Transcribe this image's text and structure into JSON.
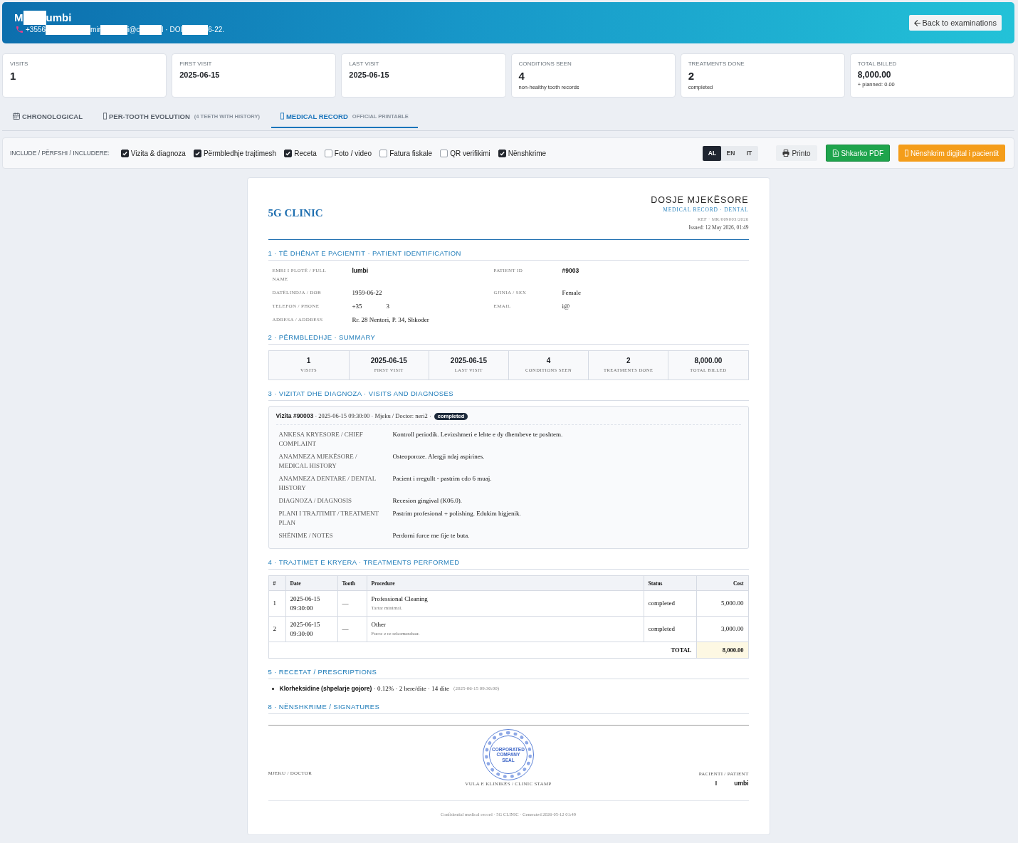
{
  "header": {
    "name_parts": [
      "M",
      "umbi"
    ],
    "contact_parts": [
      "+3556",
      "mir",
      "i@c",
      "l · DOI",
      "6-22."
    ],
    "back_button": "Back to examinations"
  },
  "stats": [
    {
      "label": "VISITS",
      "value": "1",
      "kind": "count"
    },
    {
      "label": "FIRST VISIT",
      "value": "2025-06-15",
      "kind": "date"
    },
    {
      "label": "LAST VISIT",
      "value": "2025-06-15",
      "kind": "date"
    },
    {
      "label": "CONDITIONS SEEN",
      "value": "4",
      "kind": "count",
      "note": "non-healthy tooth records"
    },
    {
      "label": "TREATMENTS DONE",
      "value": "2",
      "kind": "count",
      "note": "completed"
    },
    {
      "label": "TOTAL BILLED",
      "value": "8,000.00",
      "kind": "amount",
      "note": "+ planned: 0.00"
    }
  ],
  "tabs": [
    {
      "label": "CHRONOLOGICAL",
      "selected": false
    },
    {
      "label": "PER-TOOTH EVOLUTION",
      "note": "(4 TEETH WITH HISTORY)",
      "selected": false
    },
    {
      "label": "MEDICAL RECORD",
      "note": "OFFICIAL PRINTABLE",
      "selected": true
    }
  ],
  "toolbar": {
    "include_label": "INCLUDE / PËRFSHI / INCLUDERE:",
    "options": [
      {
        "label": "Vizita & diagnoza",
        "checked": true
      },
      {
        "label": "Përmbledhje trajtimesh",
        "checked": true
      },
      {
        "label": "Receta",
        "checked": true
      },
      {
        "label": "Foto / video",
        "checked": false
      },
      {
        "label": "Fatura fiskale",
        "checked": false
      },
      {
        "label": "QR verifikimi",
        "checked": false
      },
      {
        "label": "Nënshkrime",
        "checked": true
      }
    ],
    "languages": [
      {
        "label": "AL",
        "selected": true
      },
      {
        "label": "EN",
        "selected": false
      },
      {
        "label": "IT",
        "selected": false
      }
    ],
    "buttons": [
      {
        "label": "Printo",
        "kind": "plain"
      },
      {
        "label": "Shkarko PDF",
        "kind": "success"
      },
      {
        "label": "Nënshkrim digjital i pacientit",
        "kind": "warning"
      }
    ]
  },
  "document": {
    "clinic": "5G CLINIC",
    "title": "DOSJE MJEKËSORE",
    "subtitle": "MEDICAL RECORD · DENTAL",
    "ref": "REF · MR/009003/2026",
    "issued": "Issued: 12 May 2026, 01:49",
    "identification": {
      "heading": "1 · TË DHËNAT E PACIENTIT · PATIENT IDENTIFICATION",
      "fields": [
        {
          "label": "EMRI I PLOTË / FULL NAME",
          "value": "lumbi"
        },
        {
          "label": "PATIENT ID",
          "value": "#9003"
        },
        {
          "label": "DATËLINDJA / DOB",
          "value": "1959-06-22"
        },
        {
          "label": "GJINIA / SEX",
          "value": "Female"
        },
        {
          "label": "TELEFON / PHONE",
          "parts": [
            "+35",
            "3"
          ]
        },
        {
          "label": "EMAIL",
          "value": "i@"
        },
        {
          "label": "ADRESA / ADDRESS",
          "value": "Rr. 28 Nentori, P. 34, Shkoder"
        }
      ]
    },
    "summary": {
      "heading": "2 · PËRMBLEDHJE · SUMMARY",
      "cells": [
        {
          "value": "1",
          "label": "VISITS"
        },
        {
          "value": "2025-06-15",
          "label": "FIRST VISIT"
        },
        {
          "value": "2025-06-15",
          "label": "LAST VISIT"
        },
        {
          "value": "4",
          "label": "CONDITIONS SEEN"
        },
        {
          "value": "2",
          "label": "TREATMENTS DONE"
        },
        {
          "value": "8,000.00",
          "label": "TOTAL BILLED"
        }
      ]
    },
    "visits": {
      "heading": "3 · VIZITAT DHE DIAGNOZA · VISITS AND DIAGNOSES",
      "items": [
        {
          "header": "**Vizita #90003** · 2025-06-15 09:30:00 · Mjeku / Doctor: neri2 ·",
          "status": "completed",
          "rows": [
            {
              "label": "ANKESA KRYESORE / CHIEF COMPLAINT",
              "value": "Kontroll periodik. Levizshmeri e lehte e dy dhembeve te poshtem."
            },
            {
              "label": "ANAMNEZA MJEKËSORE / MEDICAL HISTORY",
              "value": "Osteoporoze. Alergji ndaj aspirines."
            },
            {
              "label": "ANAMNEZA DENTARE / DENTAL HISTORY",
              "value": "Pacient i rregullt - pastrim cdo 6 muaj."
            },
            {
              "label": "DIAGNOZA / DIAGNOSIS",
              "value": "Recesion gingival (K06.0)."
            },
            {
              "label": "PLANI I TRAJTIMIT / TREATMENT PLAN",
              "value": "Pastrim profesional + polishing. Edukim higjenik."
            },
            {
              "label": "SHËNIME / NOTES",
              "value": "Perdorni furce me fije te buta."
            }
          ]
        }
      ]
    },
    "treatments": {
      "heading": "4 · TRAJTIMET E KRYERA · TREATMENTS PERFORMED",
      "columns": [
        "#",
        "Date",
        "Tooth",
        "Procedure",
        "Status",
        "Cost"
      ],
      "rows": [
        {
          "num": "1",
          "date": "2025-06-15 09:30:00",
          "tooth": "—",
          "procedure": "Professional Cleaning",
          "note": "Tartar minimal.",
          "status": "completed",
          "cost": "5,000.00"
        },
        {
          "num": "2",
          "date": "2025-06-15 09:30:00",
          "tooth": "—",
          "procedure": "Other",
          "note": "Furce e re rekomanduar.",
          "status": "completed",
          "cost": "3,000.00"
        }
      ],
      "total_label": "TOTAL",
      "total": "8,000.00"
    },
    "prescriptions": {
      "heading": "5 · RECETAT / PRESCRIPTIONS",
      "items": [
        {
          "text": "**Klorheksidine (shpelarje gojore)** · 0.12% · 2 here/dite · 14 dite",
          "date": "(2025-06-15 09:30:00)"
        }
      ]
    },
    "signatures": {
      "heading": "8 · NËNSHKRIME / SIGNATURES",
      "doctor_label": "MJEKU / DOCTOR",
      "stamp_lines": [
        "CORPORATED",
        "COMPANY",
        "SEAL"
      ],
      "stamp_label": "VULA E KLINIKËS / CLINIC STAMP",
      "patient_label": "PACIENTI / PATIENT",
      "patient_name_parts": [
        "I",
        "umbi"
      ]
    },
    "footer": "Confidential medical record · 5G CLINIC · Generated 2026-05-12 01:49"
  }
}
